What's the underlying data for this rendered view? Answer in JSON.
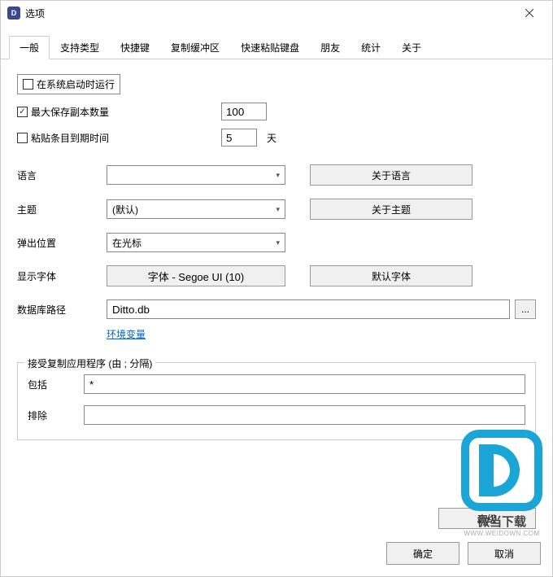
{
  "window": {
    "title": "选项",
    "icon_text": "D"
  },
  "tabs": [
    {
      "label": "一般",
      "active": true
    },
    {
      "label": "支持类型",
      "active": false
    },
    {
      "label": "快捷键",
      "active": false
    },
    {
      "label": "复制缓冲区",
      "active": false
    },
    {
      "label": "快速粘贴键盘",
      "active": false
    },
    {
      "label": "朋友",
      "active": false
    },
    {
      "label": "统计",
      "active": false
    },
    {
      "label": "关于",
      "active": false
    }
  ],
  "general": {
    "run_on_startup": {
      "label": "在系统启动时运行",
      "checked": false
    },
    "max_copies": {
      "label": "最大保存副本数量",
      "checked": true,
      "value": "100"
    },
    "expire": {
      "label": "粘贴条目到期时间",
      "checked": false,
      "value": "5",
      "unit": "天"
    },
    "language": {
      "label": "语言",
      "value": "",
      "about_btn": "关于语言"
    },
    "theme": {
      "label": "主题",
      "value": "(默认)",
      "about_btn": "关于主题"
    },
    "popup": {
      "label": "弹出位置",
      "value": "在光标"
    },
    "font": {
      "label": "显示字体",
      "btn": "字体 - Segoe UI (10)",
      "default_btn": "默认字体"
    },
    "db_path": {
      "label": "数据库路径",
      "value": "Ditto.db",
      "browse": "...",
      "env_link": "环境变量"
    },
    "apps_group": {
      "title": "接受复制应用程序 (由 ; 分隔)",
      "include_label": "包括",
      "include_value": "*",
      "exclude_label": "排除",
      "exclude_value": ""
    },
    "advanced_btn": "高级"
  },
  "buttons": {
    "ok": "确定",
    "cancel": "取消"
  },
  "watermark": {
    "text": "微当下载",
    "url": "WWW.WEIDOWN.COM"
  }
}
